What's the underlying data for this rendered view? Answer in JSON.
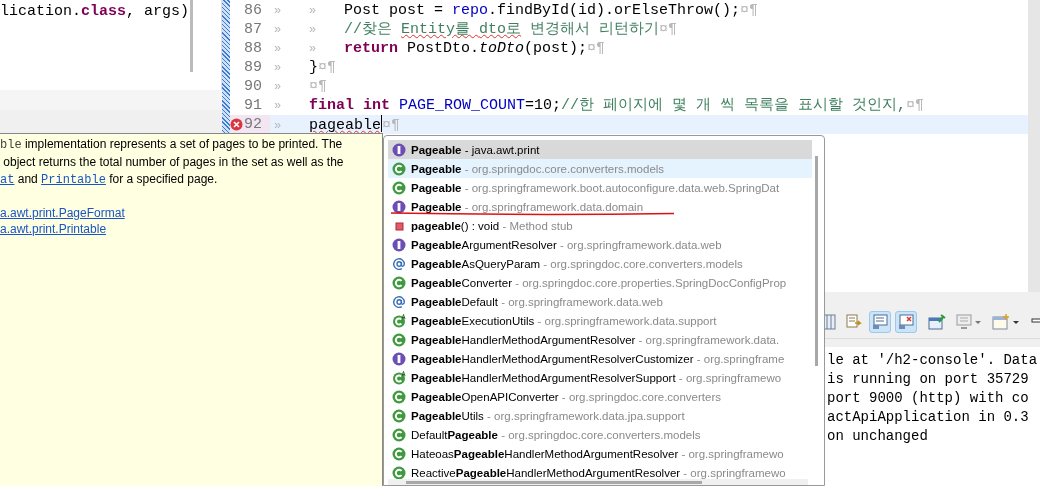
{
  "left_editor": {
    "code_line": [
      {
        "text": "lication.",
        "kind": "plain"
      },
      {
        "text": "class",
        "kind": "kw"
      },
      {
        "text": ", args)",
        "kind": "plain"
      }
    ]
  },
  "editor": {
    "lines": [
      {
        "number": "86",
        "error": false,
        "current": false,
        "segments": [
          {
            "text": "»",
            "kind": "ws"
          },
          {
            "text": "»",
            "kind": "ws"
          },
          {
            "text": "Post post = ",
            "kind": "plain"
          },
          {
            "text": "repo",
            "kind": "field"
          },
          {
            "text": ".findById(id).orElseThrow();",
            "kind": "plain"
          },
          {
            "text": "¤¶",
            "kind": "mark"
          }
        ]
      },
      {
        "number": "87",
        "error": false,
        "current": false,
        "segments": [
          {
            "text": "»",
            "kind": "ws"
          },
          {
            "text": "»",
            "kind": "ws"
          },
          {
            "text": "//찾은 ",
            "kind": "comment"
          },
          {
            "text": "Entity를 ",
            "kind": "misspelled"
          },
          {
            "text": "dto로",
            "kind": "misspelled"
          },
          {
            "text": " 변경해서 리턴하기",
            "kind": "comment"
          },
          {
            "text": "¤¶",
            "kind": "mark"
          }
        ]
      },
      {
        "number": "88",
        "error": false,
        "current": false,
        "segments": [
          {
            "text": "»",
            "kind": "ws"
          },
          {
            "text": "»",
            "kind": "ws"
          },
          {
            "text": "return",
            "kind": "kw"
          },
          {
            "text": " PostDto.",
            "kind": "plain"
          },
          {
            "text": "toDto",
            "kind": "italic"
          },
          {
            "text": "(post);",
            "kind": "plain"
          },
          {
            "text": "¤¶",
            "kind": "mark"
          }
        ]
      },
      {
        "number": "89",
        "error": false,
        "current": false,
        "segments": [
          {
            "text": "»",
            "kind": "ws"
          },
          {
            "text": "}",
            "kind": "plain"
          },
          {
            "text": "¤¶",
            "kind": "mark"
          }
        ]
      },
      {
        "number": "90",
        "error": false,
        "current": false,
        "segments": [
          {
            "text": "»",
            "kind": "ws"
          },
          {
            "text": "¤¶",
            "kind": "mark"
          }
        ]
      },
      {
        "number": "91",
        "error": false,
        "current": false,
        "segments": [
          {
            "text": "»",
            "kind": "ws"
          },
          {
            "text": "final ",
            "kind": "kw"
          },
          {
            "text": "int",
            "kind": "kw"
          },
          {
            "text": " PAGE_ROW_COUNT",
            "kind": "field"
          },
          {
            "text": "=10;",
            "kind": "plain"
          },
          {
            "text": "//한 페이지에 몇 개 씩 목록을 표시할 것인지,",
            "kind": "comment"
          },
          {
            "text": "¤¶",
            "kind": "mark"
          }
        ]
      },
      {
        "number": "92",
        "error": true,
        "current": true,
        "segments": [
          {
            "text": "»",
            "kind": "ws"
          },
          {
            "text": "pageable",
            "kind": "error"
          },
          {
            "text": "¤¶",
            "kind": "mark"
          }
        ]
      }
    ]
  },
  "javadoc": {
    "paragraph_lines": [
      [
        {
          "text": "ble",
          "kind": "code"
        },
        {
          "text": " implementation represents a set of pages to be printed. The",
          "kind": "plain"
        }
      ],
      [
        {
          "text": " object returns the total number of pages in the set as well as the",
          "kind": "plain"
        }
      ],
      [
        {
          "text": "at",
          "kind": "code-link"
        },
        {
          "text": " and ",
          "kind": "plain"
        },
        {
          "text": "Printable",
          "kind": "code-link"
        },
        {
          "text": " for a specified page.",
          "kind": "plain"
        }
      ]
    ],
    "see_also": [
      "a.awt.print.PageFormat",
      "a.awt.print.Printable"
    ]
  },
  "completion": {
    "items": [
      {
        "kind": "interface",
        "name": "**Pageable**",
        "detail": "- java.awt.print",
        "selected": true,
        "highlighted": false,
        "underlined": false
      },
      {
        "kind": "class",
        "name": "**Pageable**",
        "detail": "- org.springdoc.core.converters.models",
        "selected": false,
        "highlighted": true,
        "underlined": false
      },
      {
        "kind": "class",
        "name": "**Pageable**",
        "detail": "- org.springframework.boot.autoconfigure.data.web.SpringDat",
        "selected": false,
        "highlighted": false,
        "underlined": false
      },
      {
        "kind": "interface",
        "name": "**Pageable**",
        "detail": "- org.springframework.data.domain",
        "selected": false,
        "highlighted": false,
        "underlined": true
      },
      {
        "kind": "method",
        "name": "**pageable**() : void",
        "detail": "- Method stub",
        "selected": false,
        "highlighted": false,
        "underlined": false
      },
      {
        "kind": "interface",
        "name": "**Pageable**ArgumentResolver",
        "detail": "- org.springframework.data.web",
        "selected": false,
        "highlighted": false,
        "underlined": false
      },
      {
        "kind": "annotation",
        "name": "**Pageable**AsQueryParam",
        "detail": "- org.springdoc.core.converters.models",
        "selected": false,
        "highlighted": false,
        "underlined": false
      },
      {
        "kind": "class",
        "name": "**Pageable**Converter",
        "detail": "- org.springdoc.core.properties.SpringDocConfigProp",
        "selected": false,
        "highlighted": false,
        "underlined": false
      },
      {
        "kind": "annotation",
        "name": "**Pageable**Default",
        "detail": "- org.springframework.data.web",
        "selected": false,
        "highlighted": false,
        "underlined": false
      },
      {
        "kind": "abstract-class",
        "name": "**Pageable**ExecutionUtils",
        "detail": "- org.springframework.data.support",
        "selected": false,
        "highlighted": false,
        "underlined": false
      },
      {
        "kind": "class",
        "name": "**Pageable**HandlerMethodArgumentResolver",
        "detail": "- org.springframework.data.",
        "selected": false,
        "highlighted": false,
        "underlined": false
      },
      {
        "kind": "interface",
        "name": "**Pageable**HandlerMethodArgumentResolverCustomizer",
        "detail": "- org.springframe",
        "selected": false,
        "highlighted": false,
        "underlined": false
      },
      {
        "kind": "abstract-class",
        "name": "**Pageable**HandlerMethodArgumentResolverSupport",
        "detail": "- org.springframewo",
        "selected": false,
        "highlighted": false,
        "underlined": false
      },
      {
        "kind": "class",
        "name": "**Pageable**OpenAPIConverter",
        "detail": "- org.springdoc.core.converters",
        "selected": false,
        "highlighted": false,
        "underlined": false
      },
      {
        "kind": "class",
        "name": "**Pageable**Utils",
        "detail": "- org.springframework.data.jpa.support",
        "selected": false,
        "highlighted": false,
        "underlined": false
      },
      {
        "kind": "class",
        "name": "Default**Pageable**",
        "detail": "- org.springdoc.core.converters.models",
        "selected": false,
        "highlighted": false,
        "underlined": false
      },
      {
        "kind": "class",
        "name": "Hateoas**Pageable**HandlerMethodArgumentResolver",
        "detail": "- org.springframewo",
        "selected": false,
        "highlighted": false,
        "underlined": false
      },
      {
        "kind": "class",
        "name": "Reactive**Pageable**HandlerMethodArgumentResolver",
        "detail": "- org.springframewo",
        "selected": false,
        "highlighted": false,
        "underlined": false
      }
    ]
  },
  "console": {
    "toolbar": [
      {
        "kind": "columns",
        "pressed": false
      },
      {
        "kind": "scroll-lock",
        "pressed": false
      },
      {
        "kind": "show-output",
        "pressed": true
      },
      {
        "kind": "show-error",
        "pressed": true
      },
      {
        "kind": "pin",
        "pressed": false
      },
      {
        "kind": "display",
        "pressed": false
      },
      {
        "kind": "new-console",
        "pressed": false
      },
      {
        "kind": "minimize",
        "pressed": false
      }
    ],
    "lines": [
      "le at '/h2-console'. Data",
      "is running on port 35729",
      "port 9000 (http) with co",
      "actApiApplication in 0.3",
      "on unchanged"
    ]
  }
}
